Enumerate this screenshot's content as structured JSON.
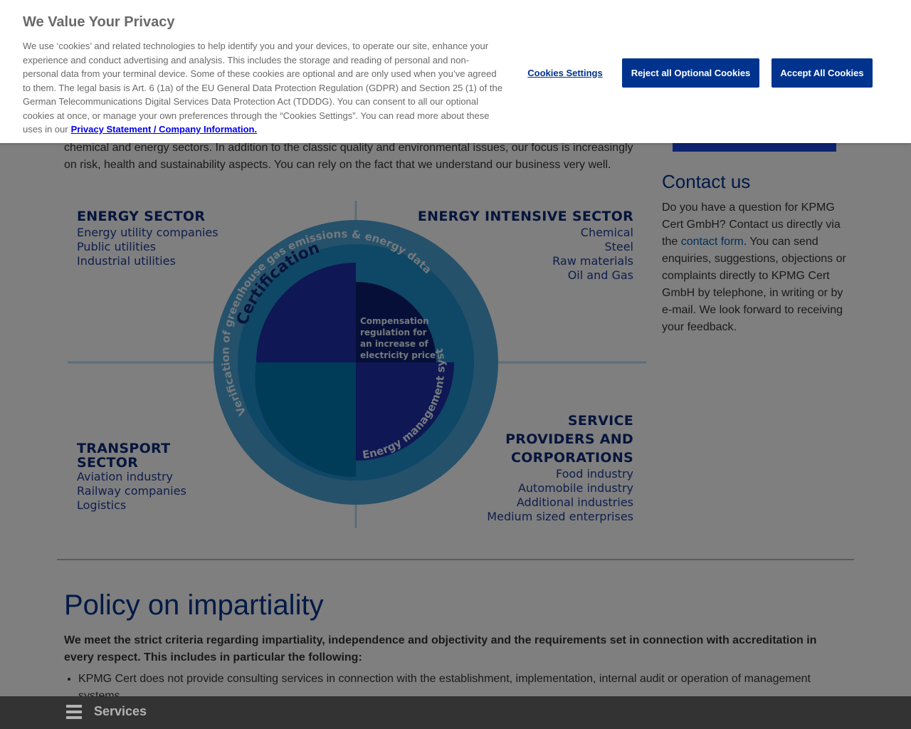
{
  "cookie_banner": {
    "title": "We Value Your Privacy",
    "body": "We use ‘cookies’ and related technologies to help identify you and your devices, to operate our site, enhance your experience and conduct advertising and analysis. This includes the storage and reading of personal and non-personal data from your terminal device. Some of these cookies are optional and are only used when you’ve agreed to them. The legal basis is Art. 6 (1a) of the EU General Data Protection Regulation (GDPR) and Section 25 (1) of the German Telecommunications Digital Services Data Protection Act (TDDDG). You can consent to all our optional cookies at once, or manage your own preferences through the “Cookies Settings”. You can read more about these uses in our",
    "link_label": "Privacy Statement / Company Information.",
    "settings_button": "Cookies Settings",
    "reject_button": "Reject all Optional Cookies",
    "accept_button": "Accept All Cookies"
  },
  "intro_text": "chemical and energy sectors. In addition to the classic quality and environmental issues, our focus is increasingly on risk, health and sustainability aspects. You can rely on the fact that we understand our business very well.",
  "contact": {
    "title": "Contact us",
    "text_before": "Do you have a question for KPMG Cert GmbH? Contact us directly via the ",
    "link": "contact form",
    "text_after": ". You can send enquiries, suggestions, objections or complaints directly to KPMG Cert GmbH by telephone, in writing or by e-mail. We look forward to receiving your feedback."
  },
  "diagram": {
    "sectors": {
      "energy": {
        "title": "ENERGY SECTOR",
        "items": [
          "Energy utility companies",
          "Public utilities",
          "Industrial utilities"
        ]
      },
      "intensive": {
        "title": "ENERGY INTENSIVE SECTOR",
        "items": [
          "Chemical",
          "Steel",
          "Raw materials",
          "Oil and Gas"
        ]
      },
      "transport": {
        "title_line1": "TRANSPORT",
        "title_line2": "SECTOR",
        "items": [
          "Aviation industry",
          "Railway companies",
          "Logistics"
        ]
      },
      "service": {
        "title_line1": "SERVICE",
        "title_line2": "PROVIDERS AND",
        "title_line3": "CORPORATIONS",
        "items": [
          "Food industry",
          "Automobile industry",
          "Additional industries",
          "Medium sized enterprises"
        ]
      }
    },
    "ring_outer": "Certification",
    "ring_middle": "Verification of greenhouse gas emissions & energy data",
    "ring_inner": "Energy management system",
    "center_lines": [
      "Compensation",
      "regulation for",
      "an increase of",
      "electricity price"
    ]
  },
  "policy": {
    "title": "Policy on impartiality",
    "lead": "We meet the strict criteria regarding impartiality, independence and objectivity and the requirements set in connection with accreditation in every respect. This includes in particular the following:",
    "items": [
      "KPMG Cert does not provide consulting services in connection with the establishment, implementation, internal audit or operation of management systems."
    ]
  },
  "bottom_bar": {
    "label": "Services"
  },
  "colors": {
    "brand": "#00338d",
    "ring_outer": "#4aa3d6",
    "ring_middle": "#1f8fcc",
    "quarter_blue": "#1e2fa8",
    "quarter_teal": "#0076b0",
    "navy": "#0c2a78"
  }
}
